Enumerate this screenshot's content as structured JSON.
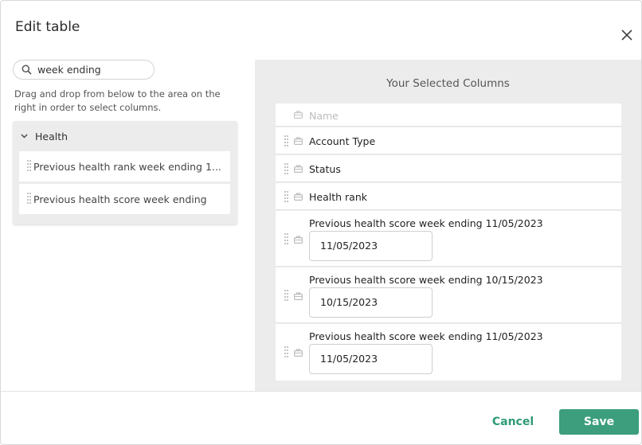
{
  "dialog": {
    "title": "Edit table"
  },
  "left": {
    "search_value": "week ending",
    "hint": "Drag and drop from below to the area on the right in order to select columns.",
    "group": {
      "label": "Health",
      "items": [
        {
          "label": "Previous health rank week ending 1..."
        },
        {
          "label": "Previous health score week ending"
        }
      ]
    }
  },
  "right": {
    "title": "Your Selected Columns",
    "placeholder_row": "Name",
    "rows": [
      {
        "label": "Account Type"
      },
      {
        "label": "Status"
      },
      {
        "label": "Health rank"
      }
    ],
    "date_rows": [
      {
        "label": "Previous health score week ending 11/05/2023",
        "date": "11/05/2023"
      },
      {
        "label": "Previous health score week ending 10/15/2023",
        "date": "10/15/2023"
      },
      {
        "label": "Previous health score week ending 11/05/2023",
        "date": "11/05/2023"
      }
    ]
  },
  "footer": {
    "cancel_label": "Cancel",
    "save_label": "Save"
  },
  "colors": {
    "accent": "#3c9e7c",
    "accent_text": "#2e9a76",
    "panel_bg": "#ececec"
  }
}
